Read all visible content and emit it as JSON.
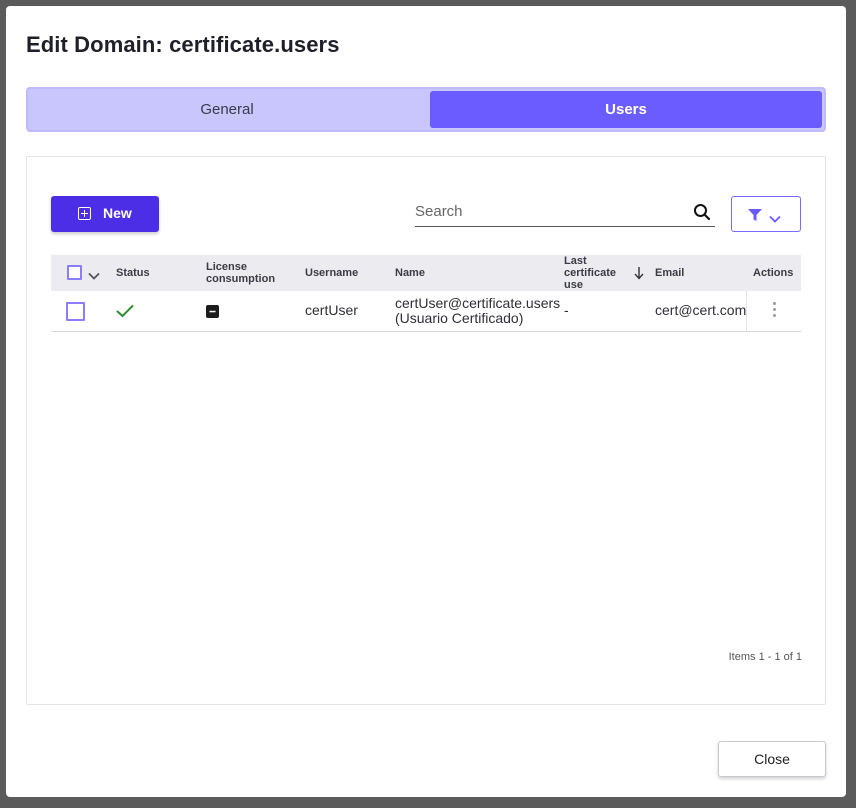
{
  "dialog": {
    "title": "Edit Domain: certificate.users",
    "tabs": [
      {
        "label": "General",
        "active": false
      },
      {
        "label": "Users",
        "active": true
      }
    ],
    "close_label": "Close"
  },
  "toolbar": {
    "new_label": "New",
    "search_placeholder": "Search",
    "filter_icon": "filter-icon"
  },
  "grid": {
    "columns": {
      "status": "Status",
      "license_line1": "License",
      "license_line2": "consumption",
      "username": "Username",
      "name": "Name",
      "last_line1": "Last",
      "last_line2": "certificate",
      "last_line3": "use",
      "email": "Email",
      "actions": "Actions"
    },
    "sort": {
      "column": "Last certificate use",
      "direction": "descending"
    },
    "rows": [
      {
        "status_icon": "check-icon",
        "license_icon": "minus-box-icon",
        "username": "certUser",
        "name_line1": "certUser@certificate.users",
        "name_line2": "(Usuario Certificado)",
        "last_certificate_use": "-",
        "email": "cert@cert.com"
      }
    ],
    "pager_text": "Items 1 - 1 of 1"
  },
  "colors": {
    "accent": "#4b2ee6",
    "tab_active": "#6b5cff",
    "tab_bar": "#c9c5fd",
    "status_ok": "#2e8b2e"
  }
}
